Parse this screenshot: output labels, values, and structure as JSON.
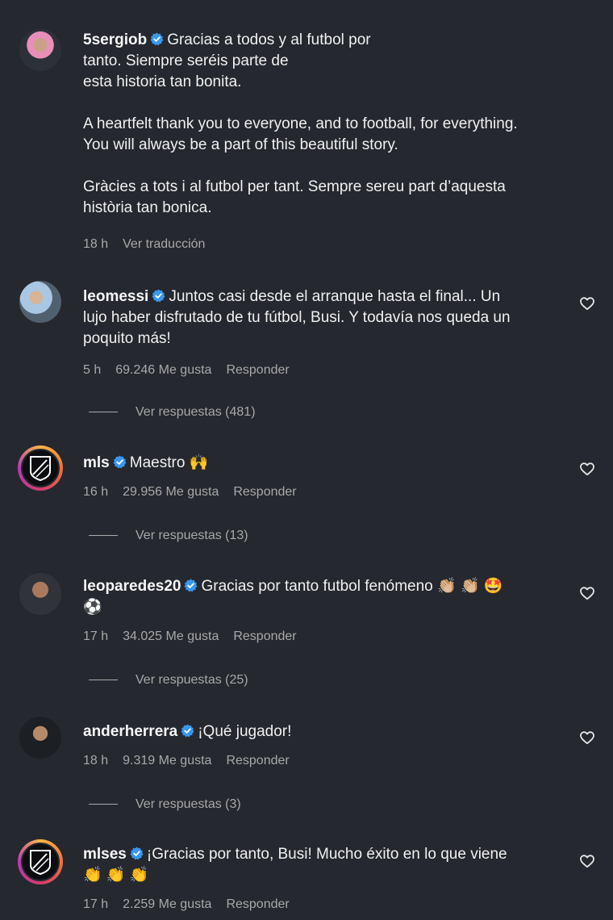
{
  "comments": [
    {
      "username": "5sergiob",
      "text_lines": [
        "Gracias a todos y al futbol por",
        "tanto. Siempre seréis parte de",
        "esta historia tan bonita."
      ],
      "para2_lines": [
        "A heartfelt thank you to everyone, and to football, for everything.",
        "You will always be a part of this beautiful story."
      ],
      "para3_lines": [
        "Gràcies a tots i al futbol per tant. Sempre sereu part d’aquesta",
        "història tan bonica."
      ],
      "time": "18 h",
      "translate": "Ver traducción"
    },
    {
      "username": "leomessi",
      "text_lines": [
        "Juntos casi desde el arranque hasta el final... Un",
        "lujo haber disfrutado de tu fútbol, Busi. Y todavía nos queda un",
        "poquito más!"
      ],
      "time": "5 h",
      "likes": "69.246 Me gusta",
      "reply": "Responder",
      "view_replies": "Ver respuestas (481)"
    },
    {
      "username": "mls",
      "text": "Maestro 🙌",
      "time": "16 h",
      "likes": "29.956 Me gusta",
      "reply": "Responder",
      "view_replies": "Ver respuestas (13)"
    },
    {
      "username": "leoparedes20",
      "text": "Gracias por tanto futbol fenómeno 👏🏼 👏🏼 🤩",
      "text_line2": "⚽",
      "time": "17 h",
      "likes": "34.025 Me gusta",
      "reply": "Responder",
      "view_replies": "Ver respuestas (25)"
    },
    {
      "username": "anderherrera",
      "text": "¡Qué jugador!",
      "time": "18 h",
      "likes": "9.319 Me gusta",
      "reply": "Responder",
      "view_replies": "Ver respuestas (3)"
    },
    {
      "username": "mlses",
      "text": "¡Gracias por tanto, Busi! Mucho éxito en lo que viene",
      "text_line2": "👏 👏 👏",
      "time": "17 h",
      "likes": "2.259 Me gusta",
      "reply": "Responder"
    }
  ],
  "colors": {
    "background": "#25282e",
    "verified": "#3897f0",
    "meta": "#a8a8a8"
  },
  "icons": {
    "verified": "verified-badge-icon",
    "like": "heart-outline-icon",
    "mls_logo": "mls-logo-icon"
  }
}
